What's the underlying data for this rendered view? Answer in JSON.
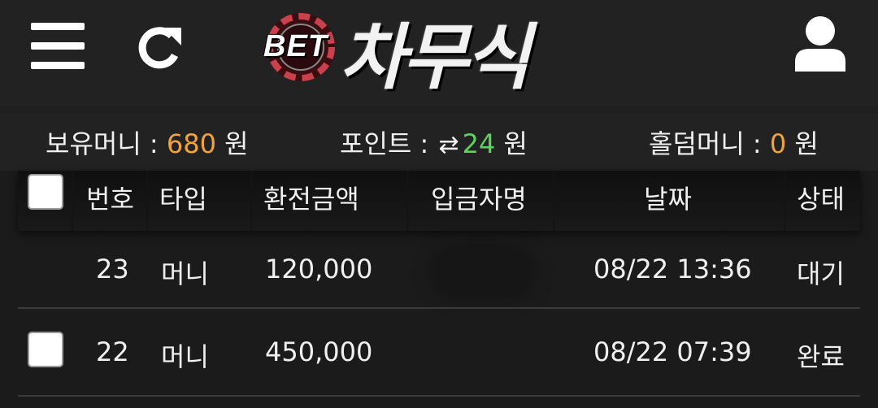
{
  "header": {
    "brand_prefix": "BET",
    "brand_name": "차무식",
    "icons": {
      "menu": "hamburger-menu-icon",
      "refresh": "refresh-icon",
      "user": "user-icon"
    }
  },
  "balances": {
    "money": {
      "label": "보유머니 :",
      "value": "680",
      "unit": "원"
    },
    "points": {
      "label": "포인트 :",
      "swap_glyph": "⇄",
      "value": "24",
      "unit": "원"
    },
    "holdem": {
      "label": "홀덤머니 :",
      "value": "0",
      "unit": "원"
    }
  },
  "table": {
    "headers": [
      "번호",
      "타입",
      "환전금액",
      "입금자명",
      "날짜",
      "상태"
    ],
    "rows": [
      {
        "no": "23",
        "type": "머니",
        "amount": "120,000",
        "depositor": "",
        "date": "08/22 13:36",
        "status": "대기",
        "has_checkbox": false
      },
      {
        "no": "22",
        "type": "머니",
        "amount": "450,000",
        "depositor": "",
        "date": "08/22 07:39",
        "status": "완료",
        "has_checkbox": true
      }
    ]
  },
  "colors": {
    "accent_orange": "#f2a33a",
    "accent_green": "#5fd35f",
    "background": "#1f1f1f"
  }
}
